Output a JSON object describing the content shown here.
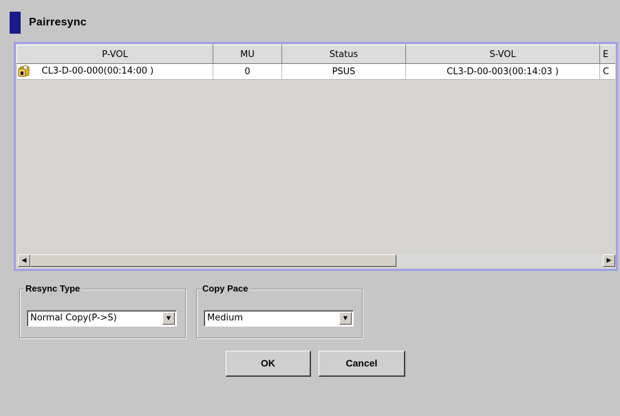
{
  "dialog": {
    "title": "Pairresync"
  },
  "table": {
    "columns": [
      "P-VOL",
      "MU",
      "Status",
      "S-VOL",
      "E"
    ],
    "rows": [
      {
        "icon": "pair-volume-icon",
        "pvol": "CL3-D-00-000(00:14:00 )",
        "mu": "0",
        "status": "PSUS",
        "svol": "CL3-D-00-003(00:14:03 )",
        "extra": "C"
      }
    ],
    "scroll": {
      "left_icon": "◀",
      "right_icon": "▶"
    }
  },
  "resync_type": {
    "label": "Resync Type",
    "value": "Normal Copy(P->S)",
    "dropdown_icon": "▼"
  },
  "copy_pace": {
    "label": "Copy Pace",
    "value": "Medium",
    "dropdown_icon": "▼"
  },
  "buttons": {
    "ok": "OK",
    "cancel": "Cancel"
  },
  "colors": {
    "background": "#c6c6c6",
    "title_accent": "#1a1a8a",
    "table_border": "#a0a0e8"
  }
}
